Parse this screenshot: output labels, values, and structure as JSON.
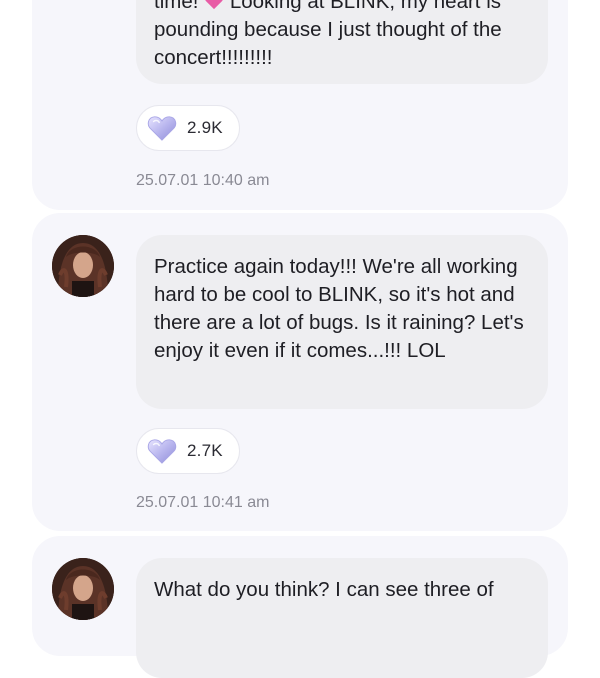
{
  "posts": [
    {
      "text_before_emoji": "time! ",
      "emoji": "pink-heart-icon",
      "text_after_emoji": " Looking at BLINK, my heart is pounding because I just thought of the concert!!!!!!!!!",
      "reaction_count": "2.9K",
      "timestamp": "25.07.01 10:40 am"
    },
    {
      "text": "Practice again today!!! We're all working hard to be cool to BLINK, so it's hot and there are a lot of bugs. Is it raining? Let's enjoy it even if it comes...!!! LOL",
      "reaction_count": "2.7K",
      "timestamp": "25.07.01 10:41 am"
    },
    {
      "text": "What do you think? I can see three of"
    }
  ],
  "colors": {
    "card_bg": "#f6f6fb",
    "bubble_bg": "#eeeef1",
    "timestamp": "#8a8a94",
    "heart_reaction": "#b9b6ee",
    "inline_heart": "#e85ca6"
  }
}
